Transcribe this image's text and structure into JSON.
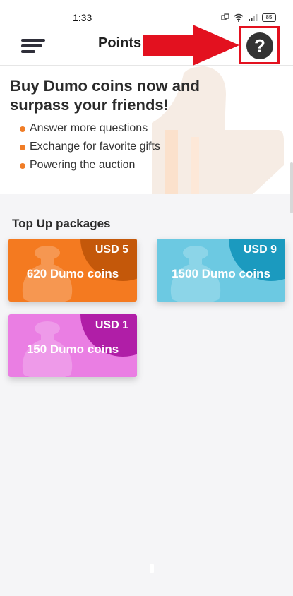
{
  "status_bar": {
    "time": "1:33",
    "battery": "85"
  },
  "app_bar": {
    "title": "Points",
    "help_symbol": "?",
    "menu_icon": "hamburger-menu-icon",
    "help_icon": "question-circle-icon"
  },
  "hero": {
    "title": "Buy Dumo coins now and surpass your friends!",
    "bullets": [
      "Answer more questions",
      "Exchange for favorite gifts",
      "Powering the auction"
    ]
  },
  "packages": {
    "title": "Top Up packages",
    "items": [
      {
        "price": "USD 5",
        "coins": "620 Dumo coins",
        "color": "#f47a20",
        "accent": "#c4580a"
      },
      {
        "price": "USD 9",
        "coins": "1500 Dumo coins",
        "color": "#6cc9e2",
        "accent": "#1b9abf"
      },
      {
        "price": "USD 1",
        "coins": "150 Dumo coins",
        "color": "#ea7ee3",
        "accent": "#b01ea7"
      }
    ]
  },
  "colors": {
    "annotation_red": "#e3111f",
    "bullet_orange": "#f07d27"
  }
}
